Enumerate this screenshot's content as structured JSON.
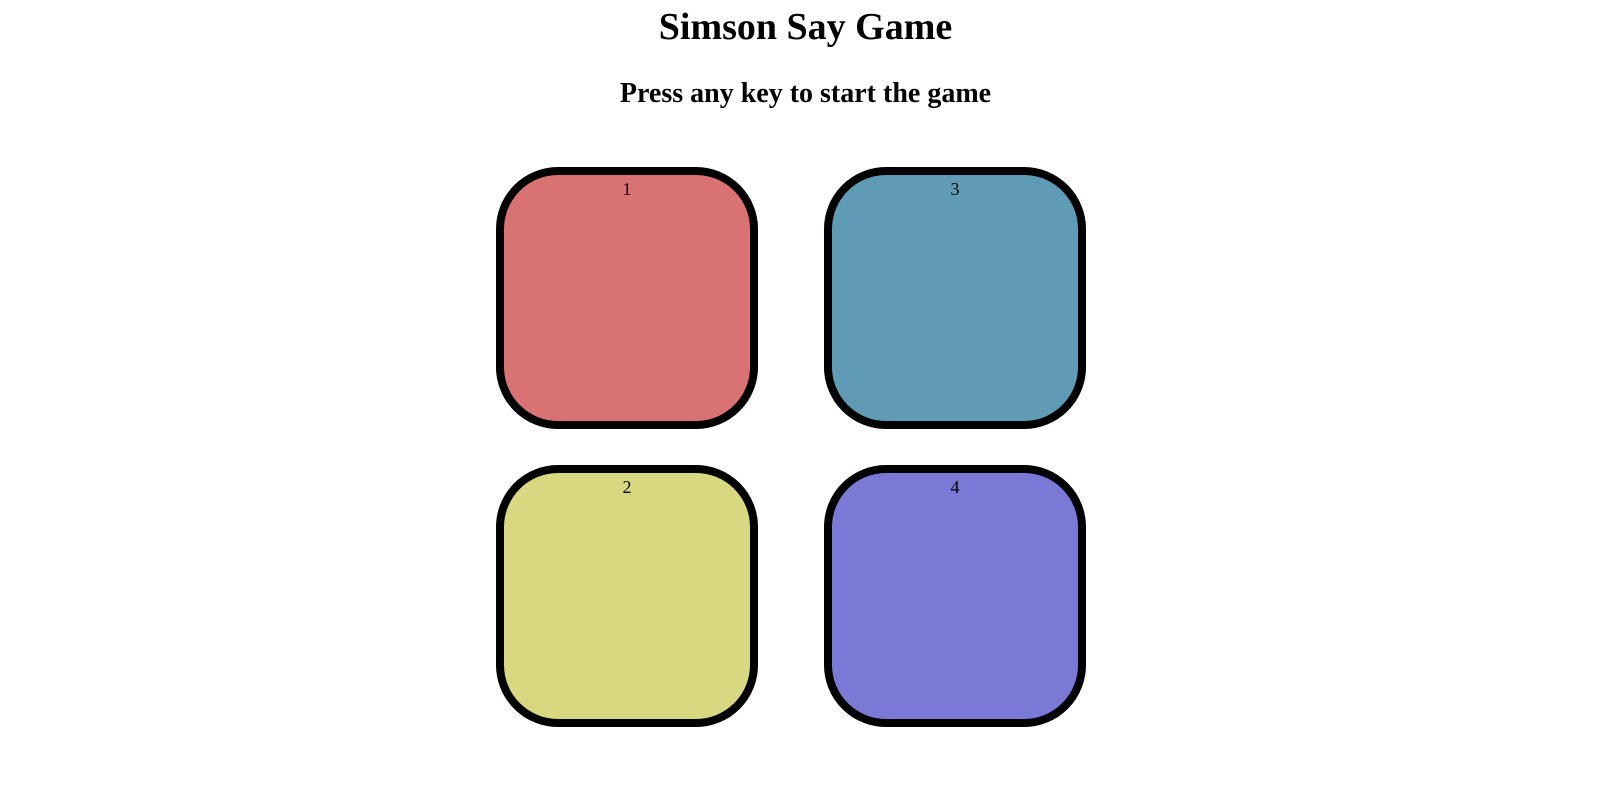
{
  "title": "Simson Say Game",
  "status": "Press any key to start the game",
  "buttons": [
    {
      "label": "1",
      "color": "#d97373"
    },
    {
      "label": "3",
      "color": "#5f9bb5"
    },
    {
      "label": "2",
      "color": "#d8d880"
    },
    {
      "label": "4",
      "color": "#7a7ad6"
    }
  ]
}
